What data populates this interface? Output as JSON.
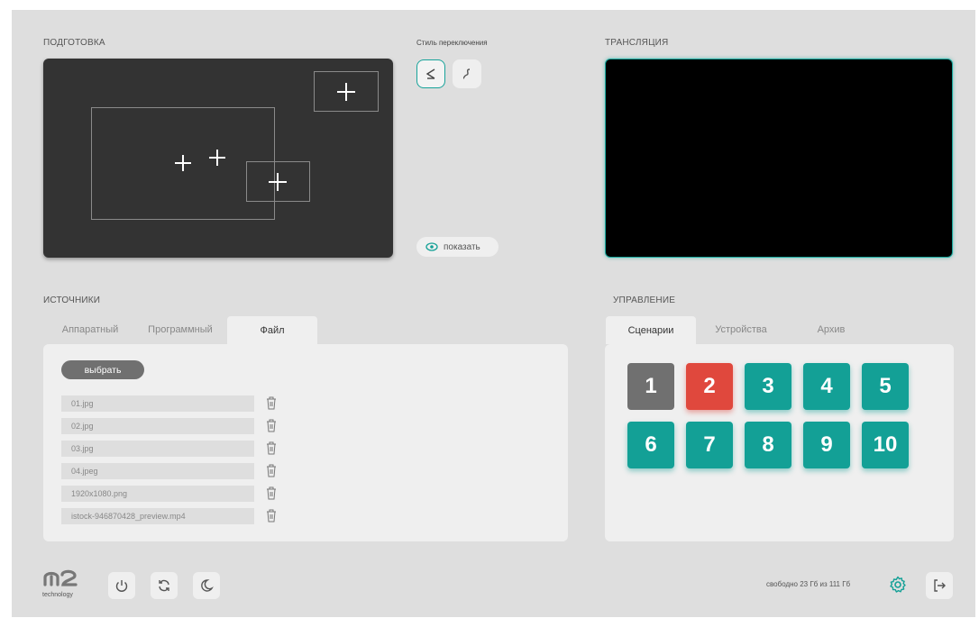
{
  "preparation": {
    "title": "ПОДГОТОВКА"
  },
  "switch_style": {
    "label": "Стиль переключения",
    "options": [
      "≤",
      "≤"
    ]
  },
  "show_button": {
    "label": "показать"
  },
  "broadcast": {
    "title": "ТРАНСЛЯЦИЯ"
  },
  "sources": {
    "title": "ИСТОЧНИКИ",
    "tabs": [
      "Аппаратный",
      "Программный",
      "Файл"
    ],
    "active_tab": "Файл",
    "choose_label": "выбрать",
    "files": [
      "01.jpg",
      "02.jpg",
      "03.jpg",
      "04.jpeg",
      "1920x1080.png",
      "istock-946870428_preview.mp4"
    ]
  },
  "control": {
    "title": "УПРАВЛЕНИЕ",
    "tabs": [
      "Сценарии",
      "Устройства",
      "Архив"
    ],
    "active_tab": "Сценарии",
    "scenes": [
      "1",
      "2",
      "3",
      "4",
      "5",
      "6",
      "7",
      "8",
      "9",
      "10"
    ]
  },
  "footer": {
    "logo_text": "technology",
    "storage": "свободно 23 Гб из 111 Гб"
  },
  "colors": {
    "accent": "#13a096",
    "danger": "#e0483d",
    "neutral": "#707070"
  },
  "icons": [
    "power-icon",
    "refresh-icon",
    "moon-icon",
    "gear-icon",
    "logout-icon",
    "trash-icon",
    "eye-icon"
  ]
}
